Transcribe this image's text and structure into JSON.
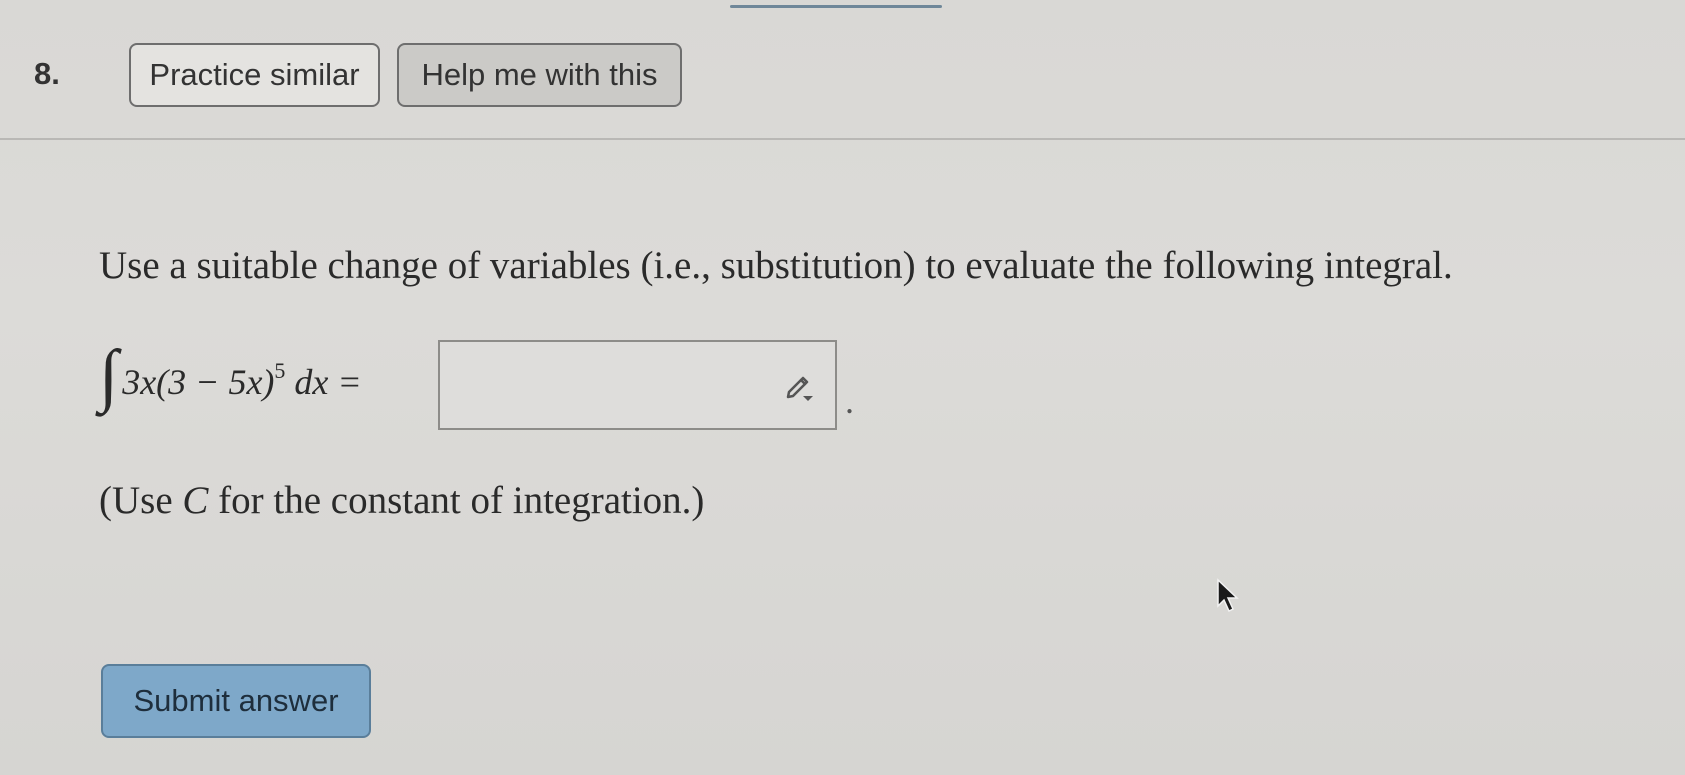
{
  "question": {
    "number": "8.",
    "practice_label": "Practice similar",
    "help_label": "Help me with this",
    "prompt": "Use a suitable change of variables (i.e., substitution) to evaluate the following integral.",
    "integral_symbol": "∫",
    "integrand": "3x(3 − 5x)",
    "exponent": "5",
    "differential": "dx =",
    "trailing_period": ".",
    "note_prefix": "(Use ",
    "note_var": "C",
    "note_suffix": " for the constant of integration.)",
    "answer_value": "",
    "submit_label": "Submit answer"
  },
  "colors": {
    "submit_bg": "#7ea8c9",
    "accent_line": "#6f8799"
  },
  "icons": {
    "math_editor": "pencil-icon",
    "pointer": "cursor-icon"
  }
}
